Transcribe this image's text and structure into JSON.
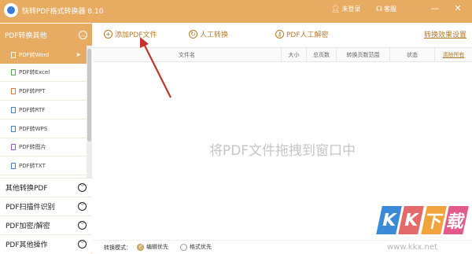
{
  "app": {
    "title": "快转PDF格式转换器 8.10"
  },
  "titlebar": {
    "login_label": "未登录",
    "service_label": "客服",
    "minimize_glyph": "—",
    "close_glyph": "✕"
  },
  "sidebar": {
    "group_active": {
      "label": "PDF转换其他"
    },
    "items": [
      {
        "label": "PDF转Word",
        "selected": true
      },
      {
        "label": "PDF转Excel"
      },
      {
        "label": "PDF转PPT"
      },
      {
        "label": "PDF转RTF"
      },
      {
        "label": "PDF转WPS"
      },
      {
        "label": "PDF转图片"
      },
      {
        "label": "PDF转TXT"
      }
    ],
    "categories": [
      {
        "label": "其他转换PDF"
      },
      {
        "label": "PDF扫描件识别"
      },
      {
        "label": "PDF加密/解密"
      },
      {
        "label": "PDF其他操作"
      }
    ]
  },
  "toolbar": {
    "add_file_label": "添加PDF文件",
    "manual_convert_label": "人工转换",
    "manual_decrypt_label": "PDF人工解密",
    "effect_settings_label": "转换效果设置"
  },
  "table": {
    "columns": [
      "文件名",
      "大小",
      "总页数",
      "转换页数范围",
      "状态",
      "清除所有"
    ]
  },
  "drop_area": {
    "hint": "将PDF文件拖拽到窗口中"
  },
  "bottombar": {
    "mode_label": "转换模式：",
    "option_edit": "编辑优先",
    "option_format": "格式优先",
    "selected": "编辑优先"
  },
  "watermark": {
    "chars": [
      "K",
      "K",
      "下",
      "载"
    ],
    "url": "www.kkx.net"
  },
  "colors": {
    "accent": "#e8ab62",
    "accent_text": "#b57a2c",
    "annotation_arrow": "#c0342c"
  }
}
